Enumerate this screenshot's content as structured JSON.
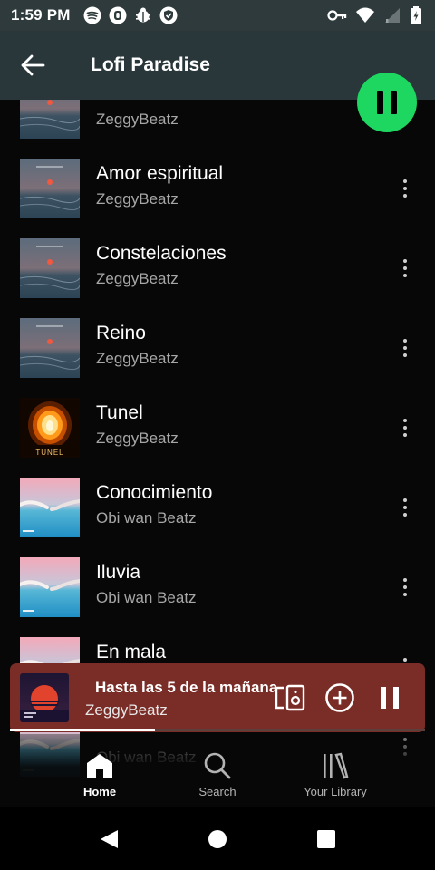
{
  "status_bar": {
    "time": "1:59 PM",
    "notification_icons": [
      "spotify-icon",
      "opera-icon",
      "bug-icon",
      "vpn-shield-icon"
    ],
    "system_icons": [
      "key-icon",
      "wifi-icon",
      "signal-icon",
      "battery-icon"
    ]
  },
  "header": {
    "title": "Lofi Paradise"
  },
  "songs": [
    {
      "title": "",
      "artist": "ZeggyBeatz",
      "art": "sea-sunset"
    },
    {
      "title": "Amor espiritual",
      "artist": "ZeggyBeatz",
      "art": "sea-sunset"
    },
    {
      "title": "Constelaciones",
      "artist": "ZeggyBeatz",
      "art": "sea-sunset"
    },
    {
      "title": "Reino",
      "artist": "ZeggyBeatz",
      "art": "sea-sunset"
    },
    {
      "title": "Tunel",
      "artist": "ZeggyBeatz",
      "art": "tunnel",
      "art_text": "TUNEL"
    },
    {
      "title": "Conocimiento",
      "artist": "Obi wan Beatz",
      "art": "hands"
    },
    {
      "title": "Iluvia",
      "artist": "Obi wan Beatz",
      "art": "hands"
    },
    {
      "title": "En mala",
      "artist": "",
      "art": "hands"
    },
    {
      "title": "",
      "artist": "Obi wan Beatz",
      "art": "hands"
    }
  ],
  "mini_player": {
    "title": "Hasta las 5 de la mañana",
    "artist": "ZeggyBeatz",
    "progress": 0.35
  },
  "bottom_nav": [
    {
      "label": "Home",
      "icon": "home-icon",
      "active": true
    },
    {
      "label": "Search",
      "icon": "search-icon",
      "active": false
    },
    {
      "label": "Your Library",
      "icon": "library-icon",
      "active": false
    }
  ],
  "colors": {
    "accent": "#1ed760",
    "header_bg": "#29373a",
    "mini_player_bg": "#7a2c26",
    "background": "#070707"
  }
}
